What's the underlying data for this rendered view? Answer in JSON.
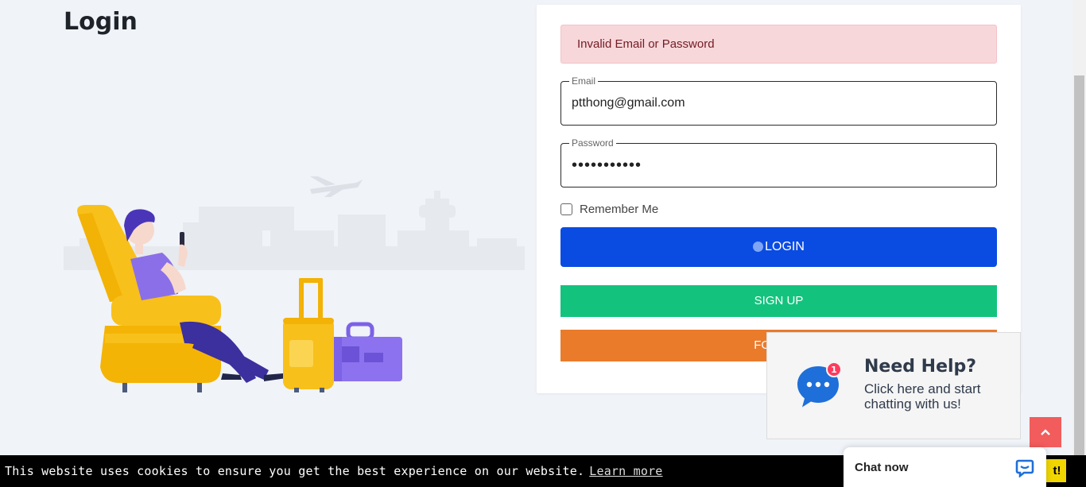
{
  "page": {
    "title": "Login"
  },
  "login_form": {
    "alert_message": "Invalid Email or Password",
    "email": {
      "label": "Email",
      "value": "ptthong@gmail.com"
    },
    "password": {
      "label": "Password",
      "value": "•••••••••••"
    },
    "remember_me": {
      "label": "Remember Me",
      "checked": false
    },
    "login_label": "LOGIN",
    "signup_label": "SIGN UP",
    "forget_label": "FORGET"
  },
  "help_widget": {
    "title": "Need Help?",
    "subtitle": "Click here and start chatting with us!",
    "badge_count": "1"
  },
  "cookie_bar": {
    "message": "This website uses cookies to ensure you get the best experience on our website.",
    "learn_more": "Learn more",
    "accept_label": "t!"
  },
  "chat": {
    "label": "Chat now"
  },
  "colors": {
    "login_button": "#0a4be2",
    "signup_button": "#13c37d",
    "forget_button": "#ea7b2b",
    "alert_background": "#f8d7da",
    "scroll_top_button": "#f25c5c",
    "chat_icon": "#1e6fd9"
  }
}
